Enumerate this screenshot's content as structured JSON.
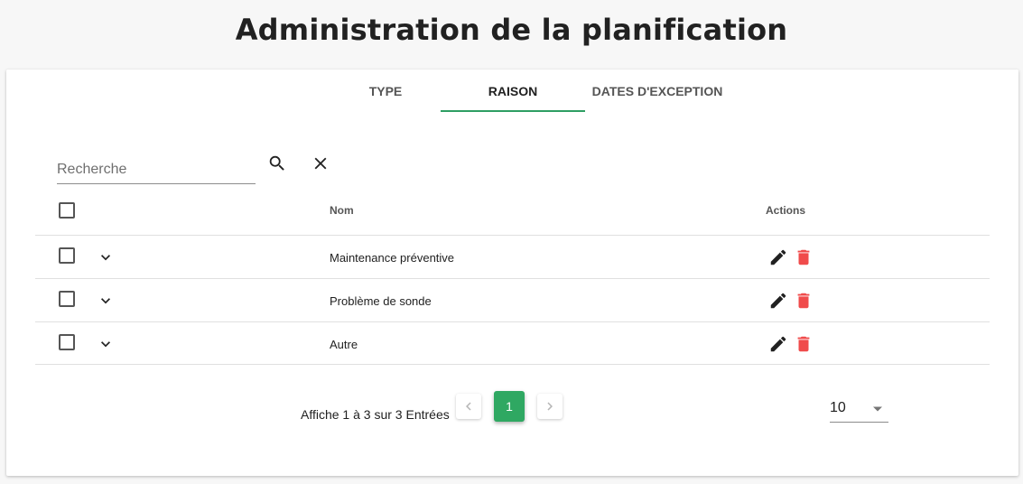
{
  "page": {
    "title": "Administration de la planification"
  },
  "tabs": [
    {
      "label": "TYPE",
      "active": false
    },
    {
      "label": "RAISON",
      "active": true
    },
    {
      "label": "DATES D'EXCEPTION",
      "active": false
    }
  ],
  "search": {
    "placeholder": "Recherche",
    "value": ""
  },
  "table": {
    "columns": {
      "name": "Nom",
      "actions": "Actions"
    },
    "rows": [
      {
        "name": "Maintenance préventive"
      },
      {
        "name": "Problème de sonde"
      },
      {
        "name": "Autre"
      }
    ]
  },
  "pagination": {
    "info": "Affiche 1 à 3 sur 3 Entrées",
    "current_page": "1",
    "per_page": "10"
  },
  "colors": {
    "accent": "#2e9e63",
    "delete": "#f04b4b",
    "edit": "#212121"
  },
  "icons": [
    "search-icon",
    "close-icon",
    "chevron-down-icon",
    "pencil-icon",
    "trash-icon",
    "chevron-left-icon",
    "chevron-right-icon",
    "caret-down-icon"
  ]
}
